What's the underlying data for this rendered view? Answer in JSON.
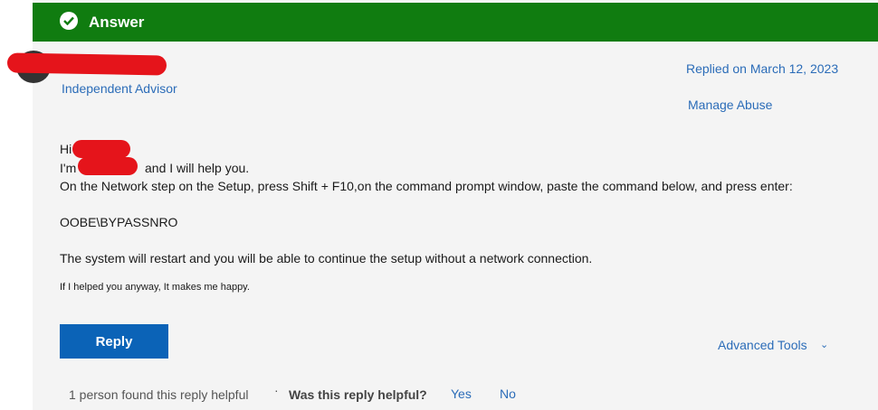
{
  "answer": {
    "label": "Answer",
    "color": "#107c10"
  },
  "author": {
    "role": "Independent Advisor"
  },
  "meta": {
    "replied": "Replied on March 12, 2023",
    "manage": "Manage Abuse"
  },
  "body": {
    "greeting": "Hi",
    "intro_prefix": "I'm",
    "intro_suffix": "and I will help you.",
    "line3": "On the Network step on the Setup, press Shift + F10,on the command prompt window, paste the command below, and press enter:",
    "command": "OOBE\\BYPASSNRO",
    "line5": "The system will restart and you will be able to continue the setup without a network connection.",
    "signature": "If I helped you anyway, It makes me happy."
  },
  "actions": {
    "reply": "Reply",
    "advanced_tools": "Advanced Tools"
  },
  "footer": {
    "helpful_count": "1 person found this reply helpful",
    "separator": "·",
    "question": "Was this reply helpful?",
    "yes": "Yes",
    "no": "No"
  },
  "icons": {
    "answer": "check-circle-icon",
    "chevron": "chevron-down-icon"
  },
  "colors": {
    "link": "#2b6cb8",
    "button": "#0b63b7",
    "redaction": "#e5141b"
  }
}
